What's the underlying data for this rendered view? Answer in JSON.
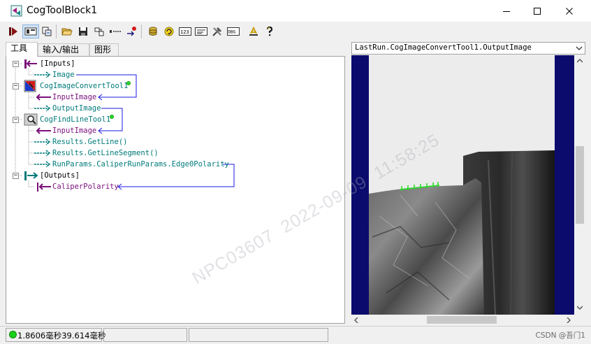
{
  "window": {
    "title": "CogToolBlock1",
    "minimize_icon": "minimize-icon",
    "maximize_icon": "maximize-icon",
    "close_icon": "close-icon"
  },
  "toolbar": {
    "buttons": [
      {
        "name": "run-icon"
      },
      {
        "name": "show-io-icon"
      },
      {
        "name": "copy-settings-icon"
      },
      {
        "name": "open-folder-icon"
      },
      {
        "name": "save-icon"
      },
      {
        "name": "tool-properties-icon"
      },
      {
        "name": "dotted-line-icon"
      },
      {
        "name": "link-icon"
      },
      {
        "name": "database-icon"
      },
      {
        "name": "refresh-icon"
      },
      {
        "name": "counter-123-icon"
      },
      {
        "name": "form-icon"
      },
      {
        "name": "tools-icon"
      },
      {
        "name": "debug-icon"
      },
      {
        "name": "measure-icon"
      },
      {
        "name": "help-icon"
      }
    ]
  },
  "tabs": [
    "工具",
    "输入/输出",
    "图形"
  ],
  "tree": {
    "inputs_label": "[Inputs]",
    "image": "Image",
    "convert_tool": "CogImageConvertTool1",
    "convert_input": "InputImage",
    "convert_output": "OutputImage",
    "find_line_tool": "CogFindLineTool1",
    "find_input": "InputImage",
    "get_line": "Results.GetLine()",
    "get_line_segment": "Results.GetLineSegment()",
    "edge_polarity": "RunParams.CaliperRunParams.Edge0Polarity",
    "outputs_label": "[Outputs]",
    "caliper_polarity": "CaliperPolarity"
  },
  "image_display": {
    "title": "LastRun.CogImageConvertTool1.OutputImage"
  },
  "watermark": "NPC03607  2022-09-09  11:58:25",
  "status": {
    "text": "1.8606毫秒39.614毫秒",
    "color": "#19d119"
  },
  "credit": "CSDN @吾门1",
  "colors": {
    "input_arrow": "#7a0f7a",
    "output_arrow": "#007a7a",
    "link_line": "#1a1ae0",
    "image_border": "#0b0b6e",
    "edge_marks": "#22dd22"
  }
}
